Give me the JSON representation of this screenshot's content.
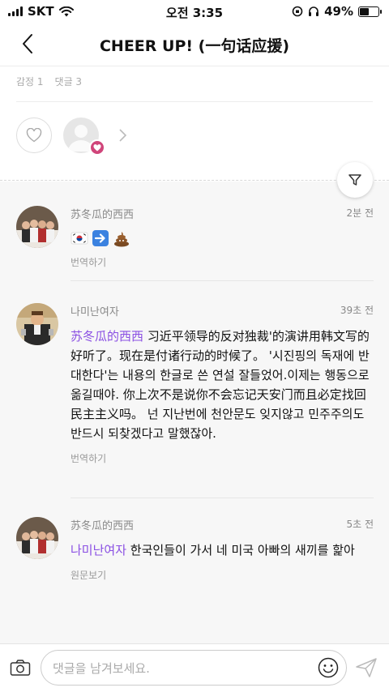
{
  "status_bar": {
    "carrier": "SKT",
    "time": "오전 3:35",
    "battery": "49%",
    "battery_level": 0.49
  },
  "header": {
    "title": "CHEER UP! (一句话应援)",
    "back_icon": "chevron-left-icon"
  },
  "meta": {
    "emotion": "감정 1",
    "comments": "댓글 3"
  },
  "reactions": {
    "heart_icon": "heart-outline-icon",
    "badge_icon": "heart-badge-icon",
    "badge_color": "#d0457a"
  },
  "filter_icon": "filter-funnel-icon",
  "comments": [
    {
      "author": "苏冬瓜的西西",
      "time": "2분 전",
      "emoji_names": [
        "flag-south-korea",
        "arrow-right",
        "pile-of-poo"
      ],
      "action": "번역하기"
    },
    {
      "author": "나미난여자",
      "time": "39초 전",
      "mention": "苏冬瓜的西西",
      "text": " 习近平领导的反对独裁'的演讲用韩文写的好听了。现在是付诸行动的时候了。 '시진핑의 독재에 반대한다'는 내용의 한글로 쓴 연설 잘들었어.이제는 행동으로 옮길때야. 你上次不是说你不会忘记天安门而且必定找回民主主义吗。 넌 지난번에 천안문도 잊지않고 민주주의도 반드시 되찾겠다고 말했잖아.",
      "action": "번역하기"
    },
    {
      "author": "苏冬瓜的西西",
      "time": "5초 전",
      "mention": "나미난여자",
      "text": " 한국인들이 가서 네 미국 아빠의 새끼를 핥아",
      "action": "원문보기"
    }
  ],
  "bottom_bar": {
    "placeholder": "댓글을 남겨보세요.",
    "camera_icon": "camera-icon",
    "emoji_icon": "smiley-icon",
    "send_icon": "send-icon"
  },
  "colors": {
    "mention": "#8a4fe3",
    "background_comments": "#f7f7f7"
  }
}
